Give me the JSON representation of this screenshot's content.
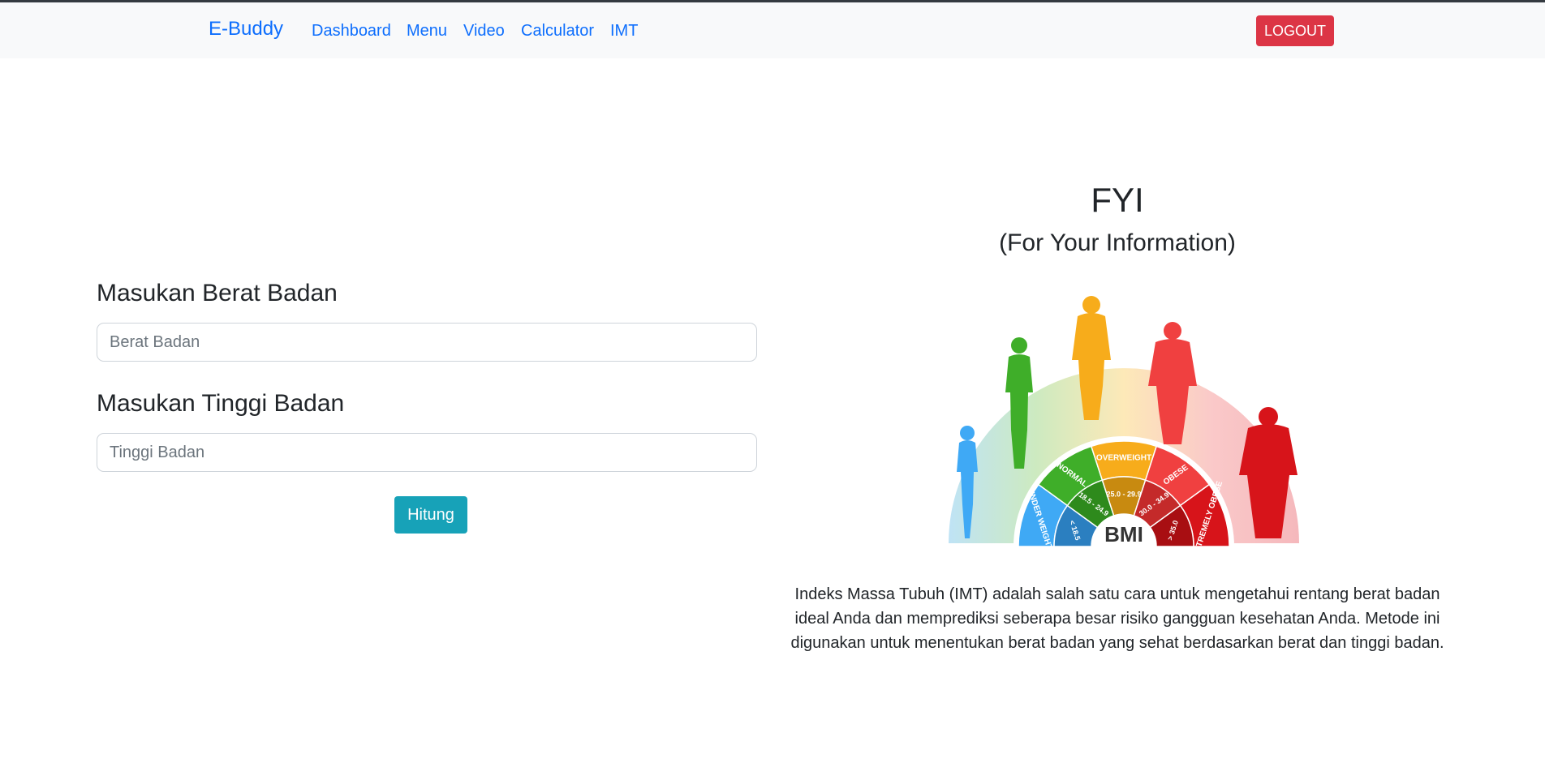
{
  "navbar": {
    "brand": "E-Buddy",
    "links": [
      "Dashboard",
      "Menu",
      "Video",
      "Calculator",
      "IMT"
    ],
    "logout_label": "LOGOUT"
  },
  "form": {
    "weight_label": "Masukan Berat Badan",
    "weight_placeholder": "Berat Badan",
    "height_label": "Masukan Tinggi Badan",
    "height_placeholder": "Tinggi Badan",
    "submit_label": "Hitung"
  },
  "info": {
    "title": "FYI",
    "subtitle": "(For Your Information)",
    "bmi_chart": {
      "center_label": "BMI",
      "categories": [
        "UNDER WEIGHT",
        "NORMAL",
        "OVERWEIGHT",
        "OBESE",
        "EXTREMELY OBESE"
      ],
      "ranges": [
        "< 18.5",
        "18.5 - 24.9",
        "25.0 - 29.9",
        "30.0 - 34.9",
        "> 35.0"
      ]
    },
    "description": "Indeks Massa Tubuh (IMT) adalah salah satu cara untuk mengetahui rentang berat badan ideal Anda dan memprediksi seberapa besar risiko gangguan kesehatan Anda. Metode ini digunakan untuk menentukan berat badan yang sehat berdasarkan berat dan tinggi badan."
  },
  "colors": {
    "link": "#0d6efd",
    "logout": "#dc3545",
    "submit": "#17a2b8",
    "underweight": "#3fa9f5",
    "normal": "#3fae29",
    "overweight": "#f7ac1b",
    "obese": "#f04040",
    "extremely_obese": "#d7141a"
  }
}
